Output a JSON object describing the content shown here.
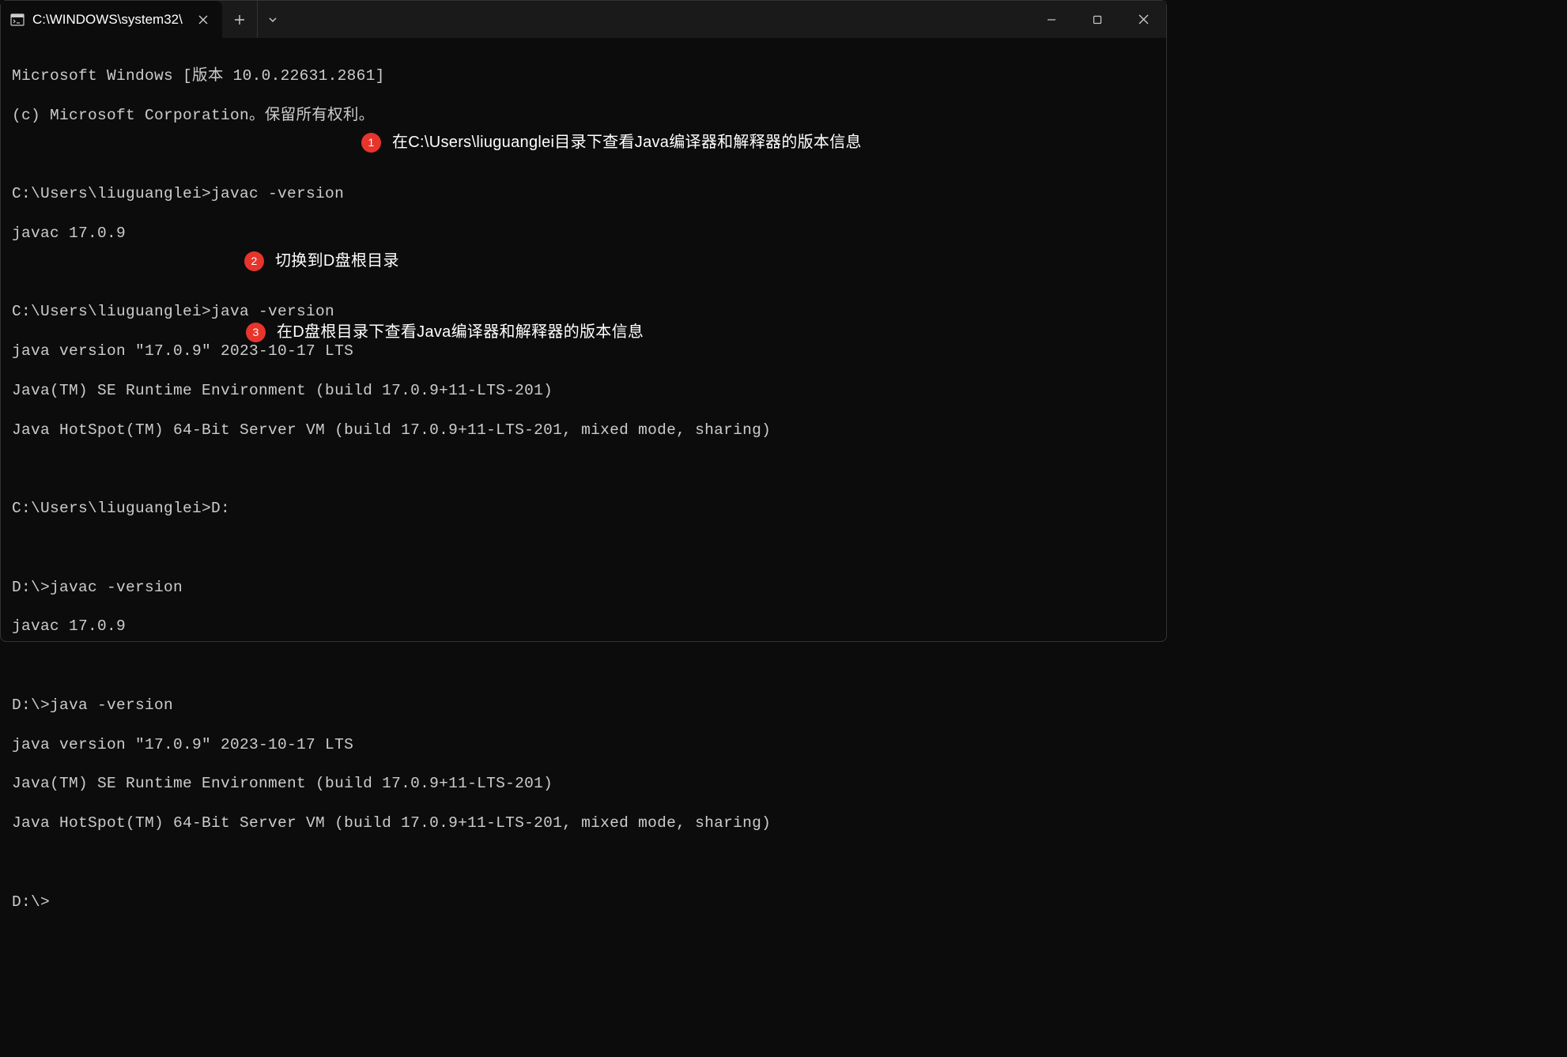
{
  "titlebar": {
    "tab_title": "C:\\WINDOWS\\system32\\"
  },
  "terminal": {
    "line1": "Microsoft Windows [版本 10.0.22631.2861]",
    "line2": "(c) Microsoft Corporation。保留所有权利。",
    "line3": "",
    "line4": "C:\\Users\\liuguanglei>javac -version",
    "line5": "javac 17.0.9",
    "line6": "",
    "line7": "C:\\Users\\liuguanglei>java -version",
    "line8": "java version \"17.0.9\" 2023-10-17 LTS",
    "line9": "Java(TM) SE Runtime Environment (build 17.0.9+11-LTS-201)",
    "line10": "Java HotSpot(TM) 64-Bit Server VM (build 17.0.9+11-LTS-201, mixed mode, sharing)",
    "line11": "",
    "line12": "C:\\Users\\liuguanglei>D:",
    "line13": "",
    "line14": "D:\\>javac -version",
    "line15": "javac 17.0.9",
    "line16": "",
    "line17": "D:\\>java -version",
    "line18": "java version \"17.0.9\" 2023-10-17 LTS",
    "line19": "Java(TM) SE Runtime Environment (build 17.0.9+11-LTS-201)",
    "line20": "Java HotSpot(TM) 64-Bit Server VM (build 17.0.9+11-LTS-201, mixed mode, sharing)",
    "line21": "",
    "line22": "D:\\>"
  },
  "annotations": {
    "a1": {
      "num": "1",
      "text": "在C:\\Users\\liuguanglei目录下查看Java编译器和解释器的版本信息"
    },
    "a2": {
      "num": "2",
      "text": "切换到D盘根目录"
    },
    "a3": {
      "num": "3",
      "text": "在D盘根目录下查看Java编译器和解释器的版本信息"
    }
  }
}
